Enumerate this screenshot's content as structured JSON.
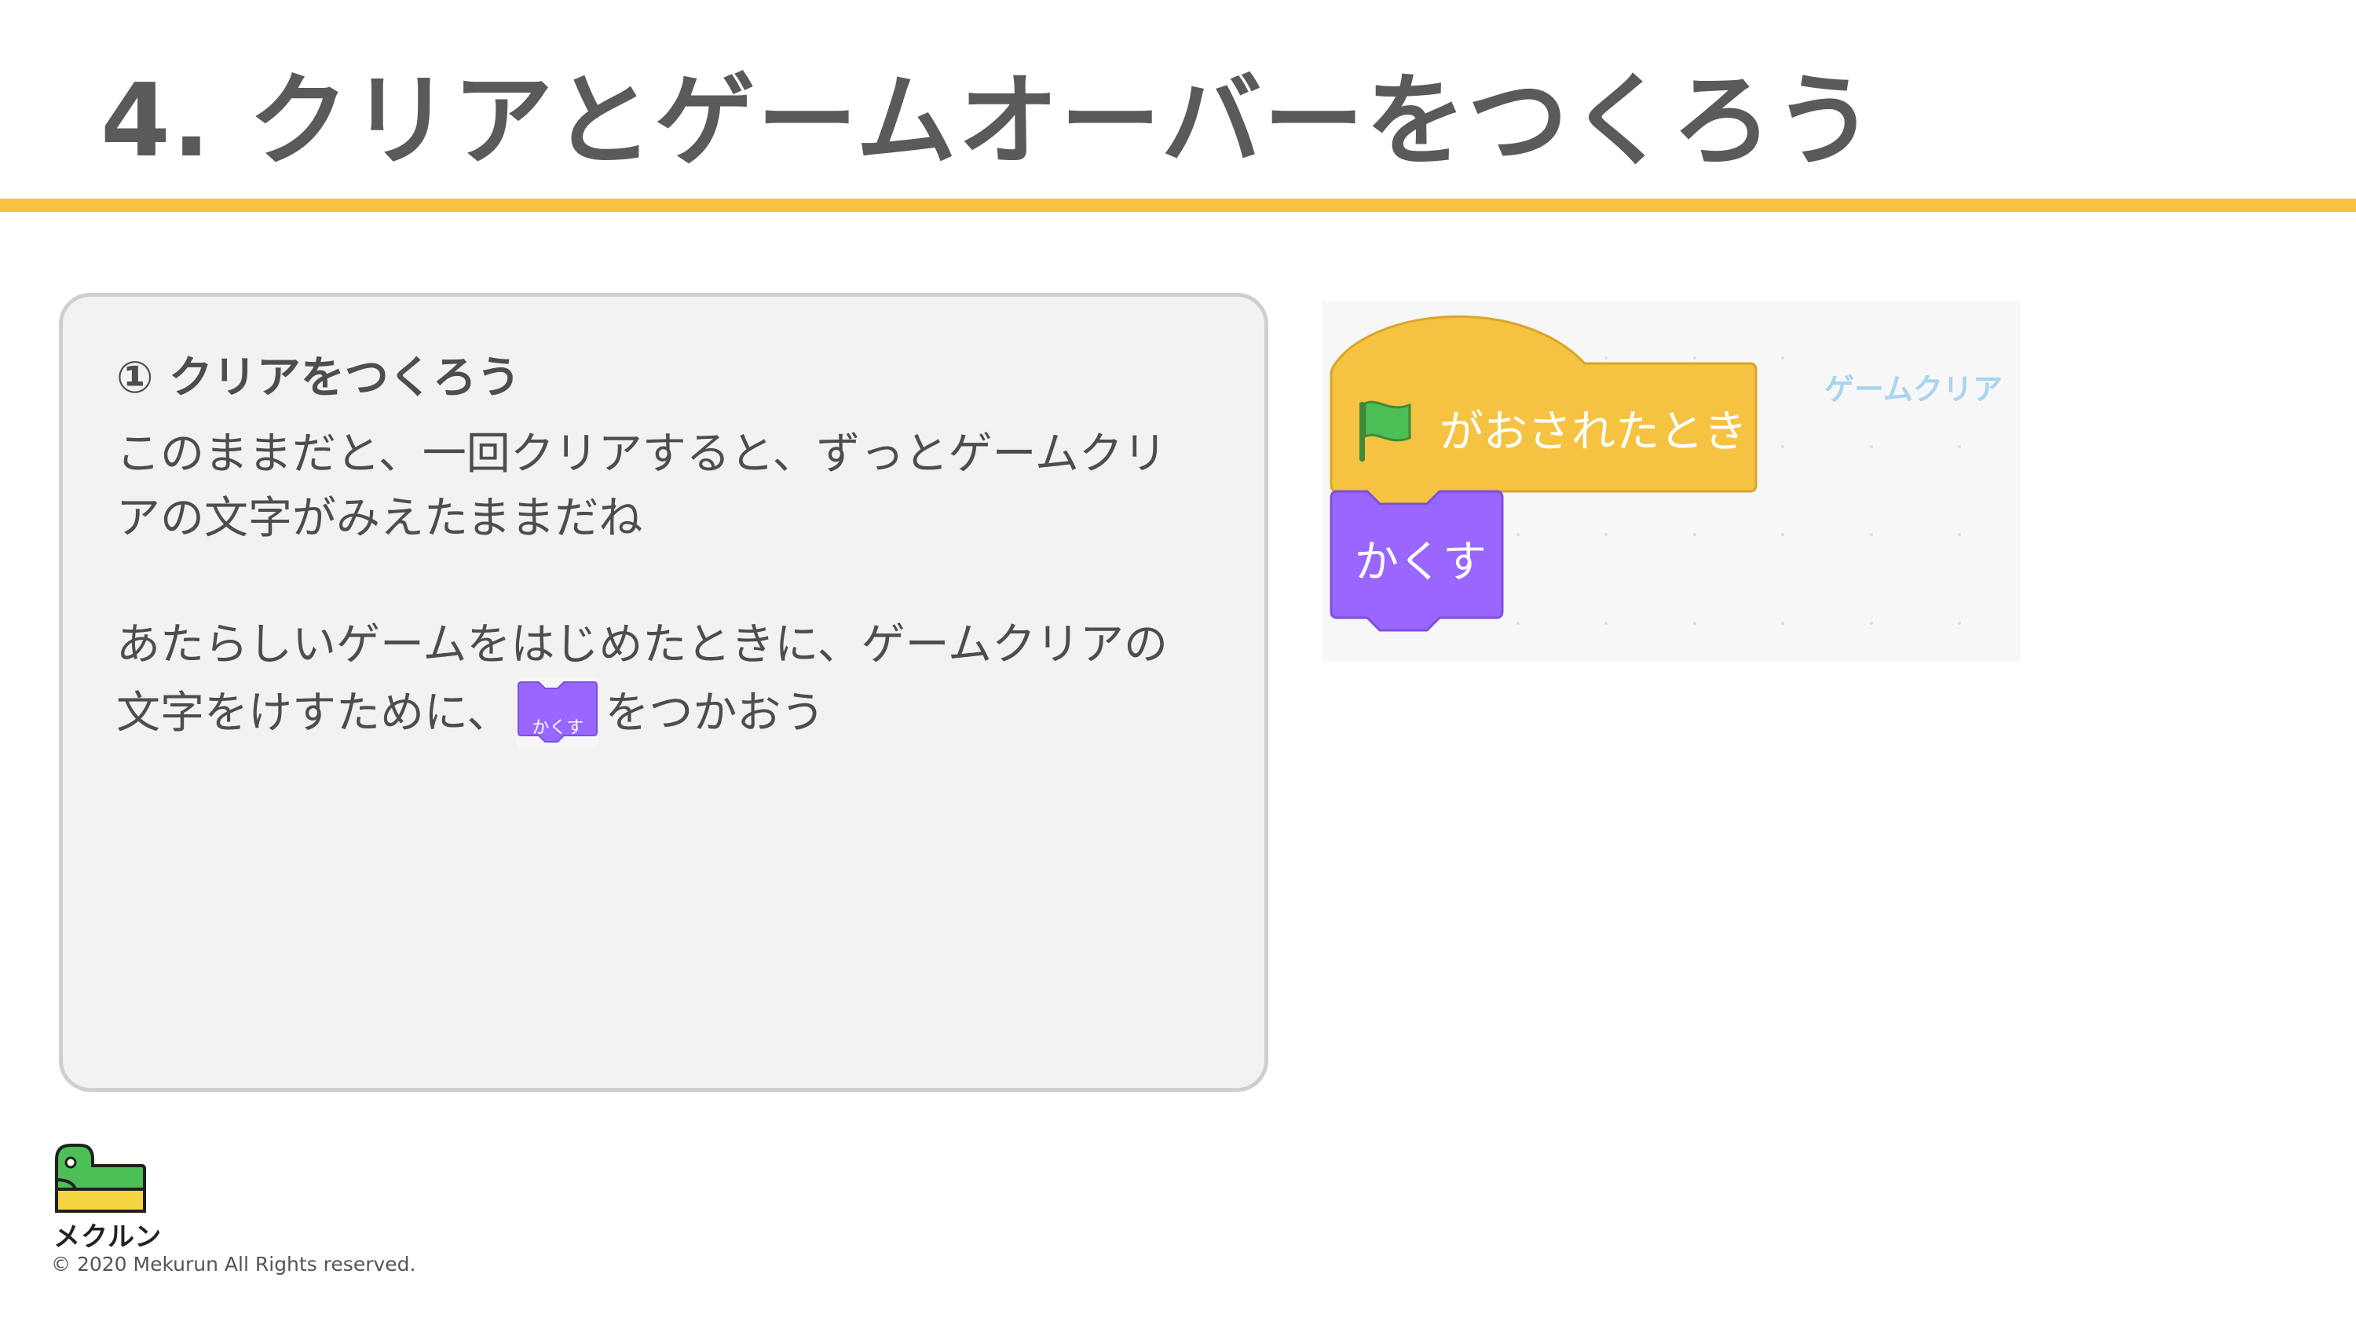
{
  "slide": {
    "title": "4. クリアとゲームオーバーをつくろう",
    "accent_color": "#f5c242"
  },
  "panel": {
    "heading": "① クリアをつくろう",
    "paragraph1_line1": "このままだと、一回クリアすると、ずっとゲームクリ",
    "paragraph1_line2": "アの文字がみえたままだね",
    "paragraph2_line1": "あたらしいゲームをはじめたときに、ゲームクリアの",
    "paragraph2_line2_before": "文字をけすために、",
    "paragraph2_line2_after": "をつかおう",
    "inline_block_label": "かくす"
  },
  "scratch_editor": {
    "hat_block_label": "がおされたとき",
    "hat_block_icon": "green-flag-icon",
    "hide_block_label": "かくす",
    "sprite_label": "ゲームクリア",
    "event_color": "#f5c242",
    "looks_color": "#9966ff"
  },
  "footer": {
    "logo_text": "メクルン",
    "copyright": "© 2020 Mekurun All Rights reserved."
  }
}
